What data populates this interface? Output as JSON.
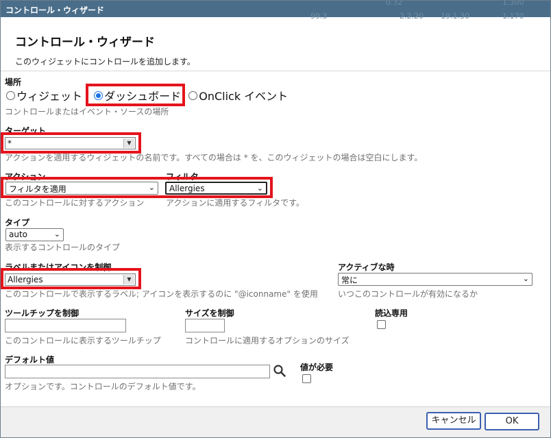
{
  "window": {
    "title": "コントロール・ウィザード",
    "ghost": [
      "0.32",
      "1.300",
      "99.3",
      "2.2.20",
      "19.1.30",
      "1.170"
    ]
  },
  "header": {
    "title": "コントロール・ウィザード",
    "description": "このウィジェットにコントロールを追加します。"
  },
  "location": {
    "label": "場所",
    "options": [
      "ウィジェット",
      "ダッシュボード",
      "OnClick イベント"
    ],
    "selected": "ダッシュボード",
    "hint": "コントロールまたはイベント・ソースの場所"
  },
  "target": {
    "label": "ターゲット",
    "value": "*",
    "hint": "アクションを適用するウィジェットの名前です。すべての場合は * を、このウィジェットの場合は空白にします。"
  },
  "action": {
    "label": "アクション",
    "value": "フィルタを適用",
    "hint": "このコントロールに対するアクション"
  },
  "filter": {
    "label": "フィルタ",
    "value": "Allergies",
    "hint": "アクションに適用するフィルタです。"
  },
  "type": {
    "label": "タイプ",
    "value": "auto",
    "hint": "表示するコントロールのタイプ"
  },
  "control_label": {
    "label": "ラベルまたはアイコンを制御",
    "value": "Allergies",
    "hint": "このコントロールで表示するラベル; アイコンを表示するのに \"@iconname\" を使用"
  },
  "active_when": {
    "label": "アクティブな時",
    "value": "常に",
    "hint": "いつこのコントロールが有効になるか"
  },
  "tooltip": {
    "label": "ツールチップを制御",
    "value": "",
    "hint": "このコントロールに表示するツールチップ"
  },
  "size": {
    "label": "サイズを制御",
    "value": "",
    "hint": "コントロールに適用するオプションのサイズ"
  },
  "readonly": {
    "label": "読込専用",
    "checked": false
  },
  "default_value": {
    "label": "デフォルト値",
    "value": "",
    "hint": "オプションです。コントロールのデフォルト値です。"
  },
  "required": {
    "label": "値が必要",
    "checked": false
  },
  "footer": {
    "cancel_label": "キャンセル",
    "ok_label": "OK"
  },
  "colors": {
    "titlebar": "#4a6e8a",
    "highlight": "#e4141c",
    "radio_selected": "#1a73e8"
  },
  "icons": {
    "search": "magnifier-icon",
    "dropdown": "chevron-down-icon"
  }
}
